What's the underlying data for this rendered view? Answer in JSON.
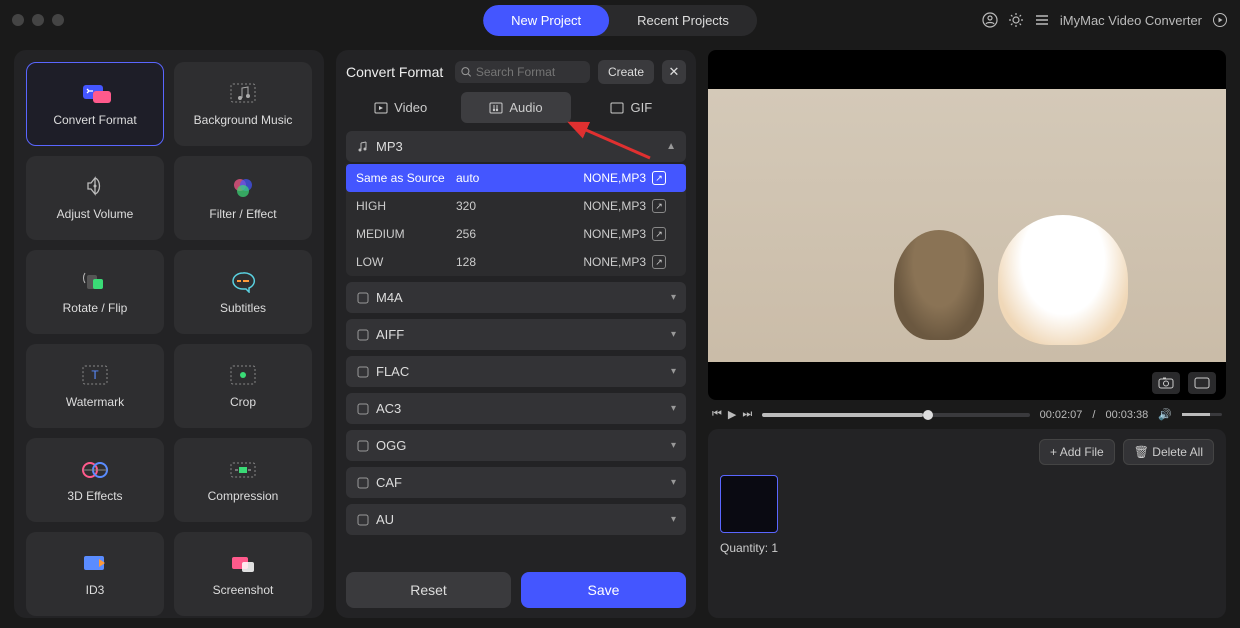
{
  "header": {
    "new_project": "New Project",
    "recent_projects": "Recent Projects",
    "app_name": "iMyMac Video Converter"
  },
  "sidebar": {
    "tools": [
      {
        "label": "Convert Format",
        "icon": "convert-icon"
      },
      {
        "label": "Background Music",
        "icon": "music-icon"
      },
      {
        "label": "Adjust Volume",
        "icon": "volume-icon"
      },
      {
        "label": "Filter / Effect",
        "icon": "filter-icon"
      },
      {
        "label": "Rotate / Flip",
        "icon": "rotate-icon"
      },
      {
        "label": "Subtitles",
        "icon": "subtitles-icon"
      },
      {
        "label": "Watermark",
        "icon": "watermark-icon"
      },
      {
        "label": "Crop",
        "icon": "crop-icon"
      },
      {
        "label": "3D Effects",
        "icon": "3d-icon"
      },
      {
        "label": "Compression",
        "icon": "compression-icon"
      },
      {
        "label": "ID3",
        "icon": "id3-icon"
      },
      {
        "label": "Screenshot",
        "icon": "screenshot-icon"
      }
    ]
  },
  "center": {
    "title": "Convert Format",
    "search_placeholder": "Search Format",
    "create": "Create",
    "tabs": {
      "video": "Video",
      "audio": "Audio",
      "gif": "GIF"
    },
    "expanded": {
      "name": "MP3",
      "rows": [
        {
          "name": "Same as Source",
          "bitrate": "auto",
          "codec": "NONE,MP3"
        },
        {
          "name": "HIGH",
          "bitrate": "320",
          "codec": "NONE,MP3"
        },
        {
          "name": "MEDIUM",
          "bitrate": "256",
          "codec": "NONE,MP3"
        },
        {
          "name": "LOW",
          "bitrate": "128",
          "codec": "NONE,MP3"
        }
      ]
    },
    "collapsed": [
      "M4A",
      "AIFF",
      "FLAC",
      "AC3",
      "OGG",
      "CAF",
      "AU"
    ],
    "reset": "Reset",
    "save": "Save"
  },
  "preview": {
    "time_current": "00:02:07",
    "time_total": "00:03:38"
  },
  "queue": {
    "add_file": "Add File",
    "delete_all": "Delete All",
    "quantity_label": "Quantity:",
    "quantity_value": "1"
  }
}
